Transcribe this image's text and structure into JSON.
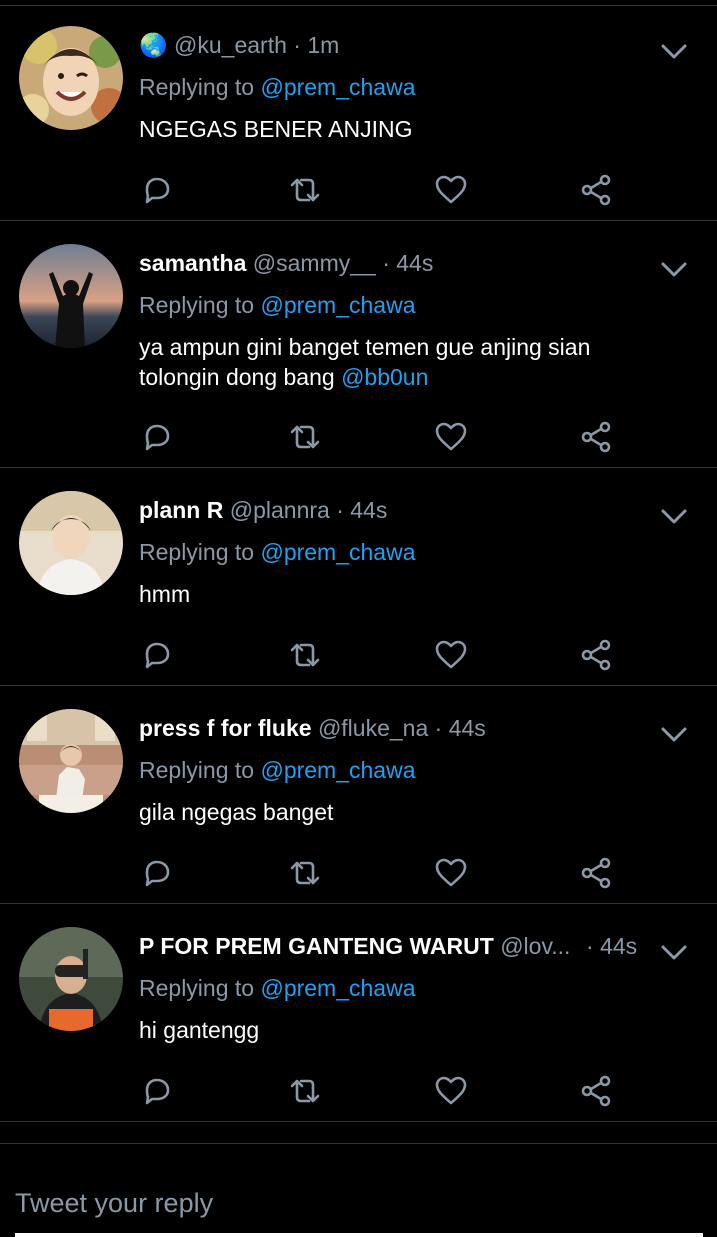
{
  "tweets": [
    {
      "avatar": "avatar-photo-smiling-person",
      "emoji": "🌏",
      "name": "",
      "handle": "@ku_earth",
      "dot": "·",
      "time": "1m",
      "replying_prefix": "Replying to",
      "replying_to": "@prem_chawa",
      "text": "NGEGAS BENER ANJING",
      "text_mention": ""
    },
    {
      "avatar": "avatar-photo-sunset-silhouette",
      "name": "samantha",
      "handle": "@sammy__",
      "dot": "·",
      "time": "44s",
      "replying_prefix": "Replying to",
      "replying_to": "@prem_chawa",
      "text": "ya ampun gini banget temen gue anjing sian tolongin dong bang ",
      "text_mention": "@bb0un"
    },
    {
      "avatar": "avatar-photo-person-white-shirt",
      "name": "plann R",
      "handle": "@plannra",
      "dot": "·",
      "time": "44s",
      "replying_prefix": "Replying to",
      "replying_to": "@prem_chawa",
      "text": "hmm",
      "text_mention": ""
    },
    {
      "avatar": "avatar-photo-person-sitting-room",
      "name": "press f for fluke",
      "handle": "@fluke_na",
      "dot": "·",
      "time": "44s",
      "replying_prefix": "Replying to",
      "replying_to": "@prem_chawa",
      "text": "gila ngegas banget",
      "text_mention": ""
    },
    {
      "avatar": "avatar-photo-snorkel-person",
      "name": "P FOR PREM GANTENG WARUT",
      "handle": "@lov...",
      "dot": "·",
      "time": "44s",
      "replying_prefix": "Replying to",
      "replying_to": "@prem_chawa",
      "text": "hi gantengg",
      "text_mention": ""
    }
  ],
  "icons": [
    "reply-icon",
    "retweet-icon",
    "like-icon",
    "share-icon",
    "chevron-down-icon"
  ],
  "colors": {
    "background": "#000000",
    "mention": "#1da1f2",
    "muted": "#8b98a5",
    "divider": "#2f3336"
  },
  "compose": {
    "placeholder": "Tweet your reply"
  }
}
